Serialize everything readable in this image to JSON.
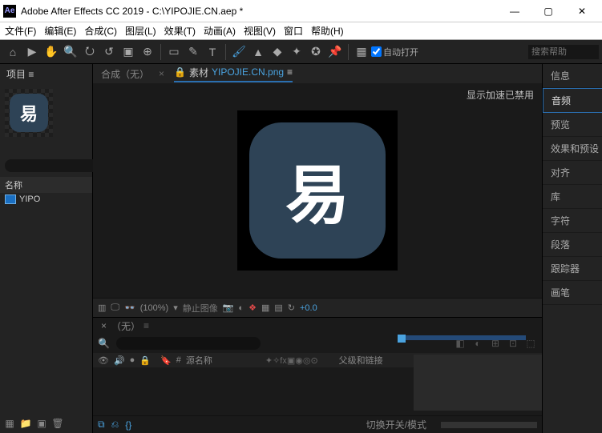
{
  "title": "Adobe After Effects CC 2019 - C:\\YIPOJIE.CN.aep *",
  "menu": [
    "文件(F)",
    "编辑(E)",
    "合成(C)",
    "图层(L)",
    "效果(T)",
    "动画(A)",
    "视图(V)",
    "窗口",
    "帮助(H)"
  ],
  "toolbar": {
    "checkbox_label": "自动打开",
    "search_placeholder": "搜索帮助"
  },
  "project": {
    "tab": "项目 ≡",
    "glyph": "易",
    "name_header": "名称",
    "item": "YIPO",
    "search_placeholder": ""
  },
  "viewer": {
    "tab1": "合成（无）",
    "tab2_prefix": "素材",
    "tab2_file": "YIPOJIE.CN.png",
    "message": "显示加速已禁用",
    "glyph": "易",
    "zoom": "(100%)",
    "status": "静止图像",
    "exposure": "+0.0"
  },
  "panels": [
    "信息",
    "音频",
    "预览",
    "效果和预设",
    "对齐",
    "库",
    "字符",
    "段落",
    "跟踪器",
    "画笔"
  ],
  "panels_active_index": 1,
  "timeline": {
    "title": "（无）",
    "col_source": "源名称",
    "col_parent": "父级和链接",
    "toggle": "切换开关/模式",
    "search_placeholder": ""
  }
}
